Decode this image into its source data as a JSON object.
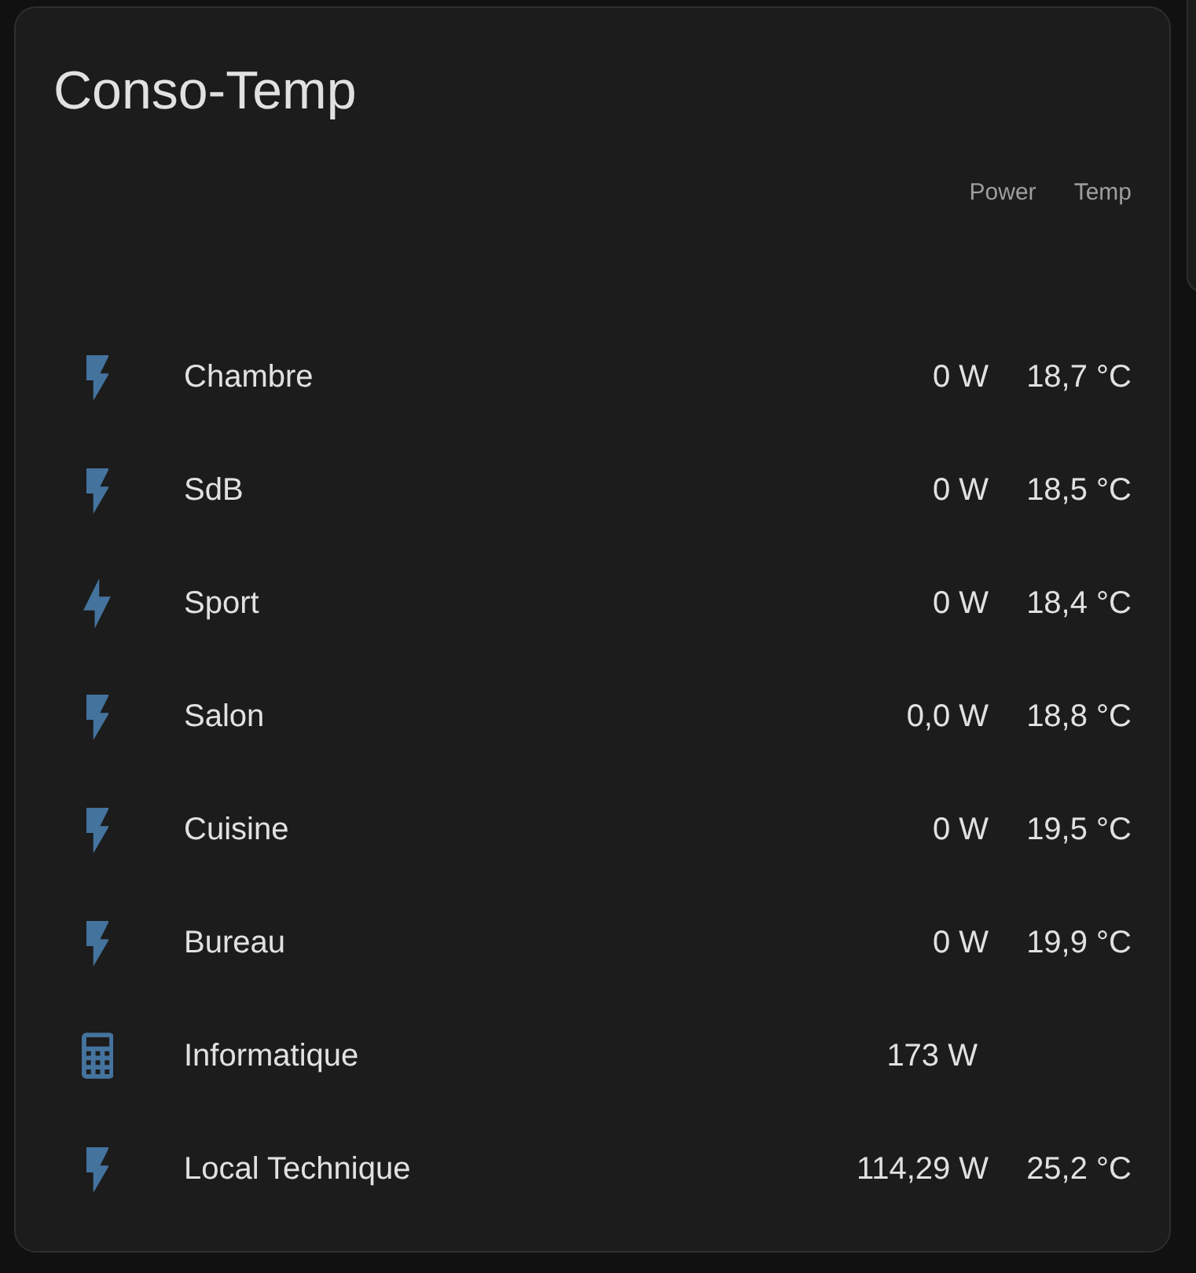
{
  "card": {
    "title": "Conso-Temp",
    "columns": [
      "Power",
      "Temp"
    ],
    "rows": [
      {
        "name": "Chambre",
        "kind": "flash",
        "power": "0 W",
        "temp": "18,7 °C"
      },
      {
        "name": "SdB",
        "kind": "flash",
        "power": "0 W",
        "temp": "18,5 °C"
      },
      {
        "name": "Sport",
        "kind": "bolt",
        "power": "0 W",
        "temp": "18,4 °C"
      },
      {
        "name": "Salon",
        "kind": "flash",
        "power": "0,0 W",
        "temp": "18,8 °C"
      },
      {
        "name": "Cuisine",
        "kind": "flash",
        "power": "0 W",
        "temp": "19,5 °C"
      },
      {
        "name": "Bureau",
        "kind": "flash",
        "power": "0 W",
        "temp": "19,9 °C"
      },
      {
        "name": "Informatique",
        "kind": "calculator",
        "power": "173 W"
      },
      {
        "name": "Local Technique",
        "kind": "flash",
        "power": "114,29 W",
        "temp": "25,2 °C"
      }
    ]
  }
}
